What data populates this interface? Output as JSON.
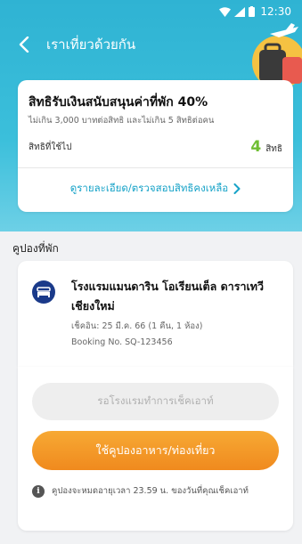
{
  "status_bar": {
    "time": "12:30"
  },
  "header": {
    "title": "เราเที่ยวด้วยกัน",
    "back_icon": "chevron-left-icon"
  },
  "rights_card": {
    "title": "สิทธิรับเงินสนับสนุนค่าที่พัก 40%",
    "subtitle": "ไม่เกิน 3,000 บาทต่อสิทธิ และไม่เกิน 5 สิทธิต่อคน",
    "used_label": "สิทธิที่ใช้ไป",
    "used_count": "4",
    "used_unit": "สิทธิ",
    "details_link": "ดูรายละเอียด/ตรวจสอบสิทธิคงเหลือ"
  },
  "section": {
    "title": "คูปองที่พัก"
  },
  "hotel": {
    "name": "โรงแรมแมนดาริน โอเรียนเต็ล ดาราเทวี เชียงใหม่",
    "checkin": "เช็คอิน: 25 มี.ค. 66 (1 คืน, 1 ห้อง)",
    "booking": "Booking No. SQ-123456",
    "icon": "bed-icon"
  },
  "actions": {
    "waiting_checkout": "รอโรงแรมทำการเช็คเอาท์",
    "use_coupon": "ใช้คูปองอาหาร/ท่องเที่ยว",
    "note": "คูปองจะหมดอายุเวลา 23.59 น. ของวันที่คุณเช็คเอาท์"
  },
  "colors": {
    "header": "#2fb3d3",
    "accent_link": "#18a3c8",
    "used_count": "#6fbe32",
    "primary_button": "#f08a1e",
    "hotel_icon": "#1a3a8a"
  }
}
